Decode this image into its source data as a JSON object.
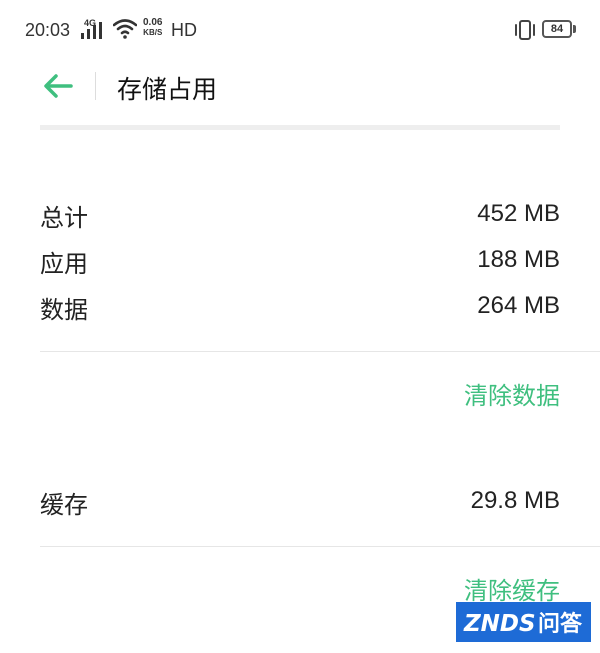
{
  "status_bar": {
    "time": "20:03",
    "network": "4G",
    "speed_value": "0.06",
    "speed_unit": "KB/S",
    "hd": "HD",
    "battery": "84"
  },
  "header": {
    "title": "存储占用",
    "back_icon": "arrow-left-icon"
  },
  "storage": {
    "rows": [
      {
        "label": "总计",
        "value": "452 MB"
      },
      {
        "label": "应用",
        "value": "188 MB"
      },
      {
        "label": "数据",
        "value": "264 MB"
      }
    ],
    "clear_data_label": "清除数据"
  },
  "cache": {
    "label": "缓存",
    "value": "29.8 MB",
    "clear_cache_label": "清除缓存"
  },
  "watermark": {
    "brand": "ZNDS",
    "suffix": "问答"
  },
  "colors": {
    "accent": "#3fbf7f",
    "watermark_bg": "#1e6bd6"
  }
}
